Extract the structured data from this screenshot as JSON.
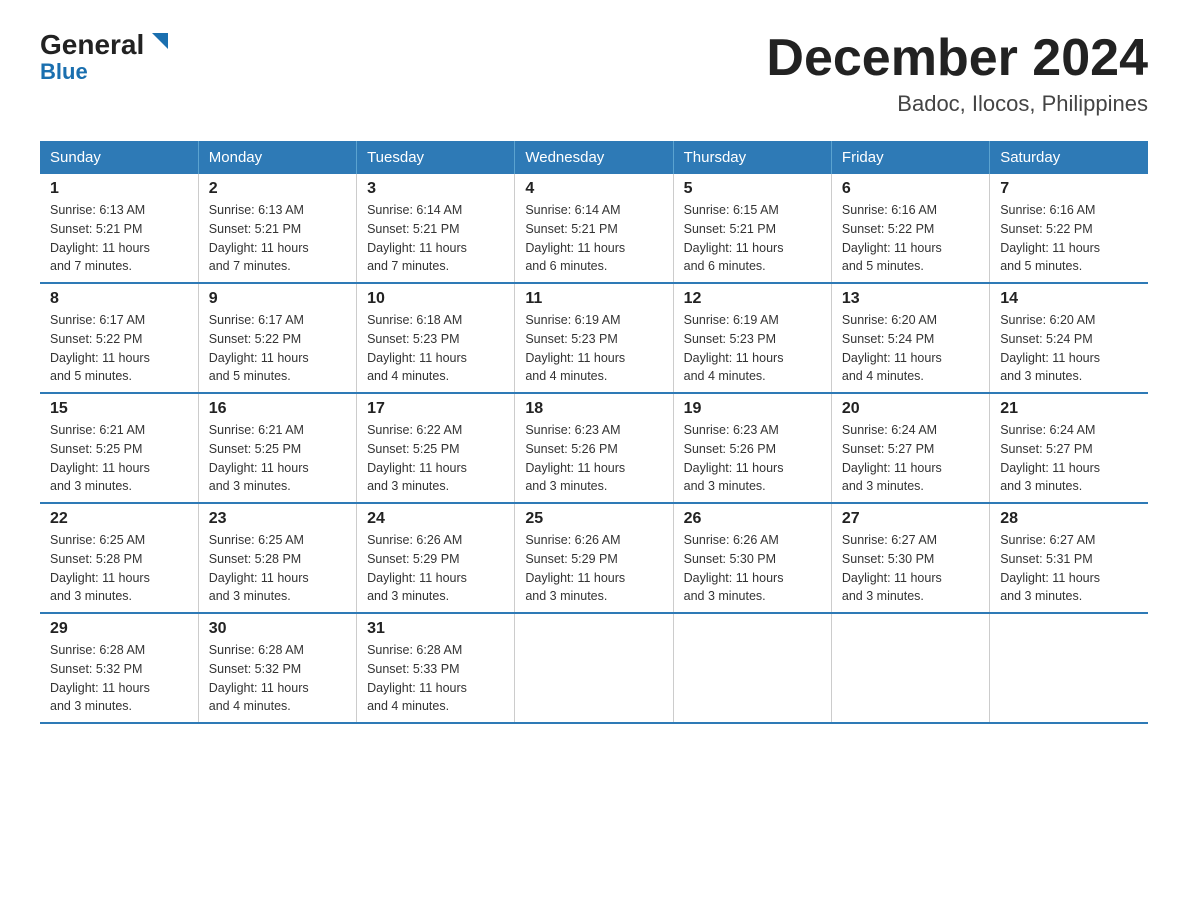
{
  "header": {
    "logo_general": "General",
    "logo_blue": "Blue",
    "title": "December 2024",
    "subtitle": "Badoc, Ilocos, Philippines"
  },
  "days_of_week": [
    "Sunday",
    "Monday",
    "Tuesday",
    "Wednesday",
    "Thursday",
    "Friday",
    "Saturday"
  ],
  "weeks": [
    [
      {
        "day": "1",
        "sunrise": "6:13 AM",
        "sunset": "5:21 PM",
        "daylight": "11 hours and 7 minutes."
      },
      {
        "day": "2",
        "sunrise": "6:13 AM",
        "sunset": "5:21 PM",
        "daylight": "11 hours and 7 minutes."
      },
      {
        "day": "3",
        "sunrise": "6:14 AM",
        "sunset": "5:21 PM",
        "daylight": "11 hours and 7 minutes."
      },
      {
        "day": "4",
        "sunrise": "6:14 AM",
        "sunset": "5:21 PM",
        "daylight": "11 hours and 6 minutes."
      },
      {
        "day": "5",
        "sunrise": "6:15 AM",
        "sunset": "5:21 PM",
        "daylight": "11 hours and 6 minutes."
      },
      {
        "day": "6",
        "sunrise": "6:16 AM",
        "sunset": "5:22 PM",
        "daylight": "11 hours and 5 minutes."
      },
      {
        "day": "7",
        "sunrise": "6:16 AM",
        "sunset": "5:22 PM",
        "daylight": "11 hours and 5 minutes."
      }
    ],
    [
      {
        "day": "8",
        "sunrise": "6:17 AM",
        "sunset": "5:22 PM",
        "daylight": "11 hours and 5 minutes."
      },
      {
        "day": "9",
        "sunrise": "6:17 AM",
        "sunset": "5:22 PM",
        "daylight": "11 hours and 5 minutes."
      },
      {
        "day": "10",
        "sunrise": "6:18 AM",
        "sunset": "5:23 PM",
        "daylight": "11 hours and 4 minutes."
      },
      {
        "day": "11",
        "sunrise": "6:19 AM",
        "sunset": "5:23 PM",
        "daylight": "11 hours and 4 minutes."
      },
      {
        "day": "12",
        "sunrise": "6:19 AM",
        "sunset": "5:23 PM",
        "daylight": "11 hours and 4 minutes."
      },
      {
        "day": "13",
        "sunrise": "6:20 AM",
        "sunset": "5:24 PM",
        "daylight": "11 hours and 4 minutes."
      },
      {
        "day": "14",
        "sunrise": "6:20 AM",
        "sunset": "5:24 PM",
        "daylight": "11 hours and 3 minutes."
      }
    ],
    [
      {
        "day": "15",
        "sunrise": "6:21 AM",
        "sunset": "5:25 PM",
        "daylight": "11 hours and 3 minutes."
      },
      {
        "day": "16",
        "sunrise": "6:21 AM",
        "sunset": "5:25 PM",
        "daylight": "11 hours and 3 minutes."
      },
      {
        "day": "17",
        "sunrise": "6:22 AM",
        "sunset": "5:25 PM",
        "daylight": "11 hours and 3 minutes."
      },
      {
        "day": "18",
        "sunrise": "6:23 AM",
        "sunset": "5:26 PM",
        "daylight": "11 hours and 3 minutes."
      },
      {
        "day": "19",
        "sunrise": "6:23 AM",
        "sunset": "5:26 PM",
        "daylight": "11 hours and 3 minutes."
      },
      {
        "day": "20",
        "sunrise": "6:24 AM",
        "sunset": "5:27 PM",
        "daylight": "11 hours and 3 minutes."
      },
      {
        "day": "21",
        "sunrise": "6:24 AM",
        "sunset": "5:27 PM",
        "daylight": "11 hours and 3 minutes."
      }
    ],
    [
      {
        "day": "22",
        "sunrise": "6:25 AM",
        "sunset": "5:28 PM",
        "daylight": "11 hours and 3 minutes."
      },
      {
        "day": "23",
        "sunrise": "6:25 AM",
        "sunset": "5:28 PM",
        "daylight": "11 hours and 3 minutes."
      },
      {
        "day": "24",
        "sunrise": "6:26 AM",
        "sunset": "5:29 PM",
        "daylight": "11 hours and 3 minutes."
      },
      {
        "day": "25",
        "sunrise": "6:26 AM",
        "sunset": "5:29 PM",
        "daylight": "11 hours and 3 minutes."
      },
      {
        "day": "26",
        "sunrise": "6:26 AM",
        "sunset": "5:30 PM",
        "daylight": "11 hours and 3 minutes."
      },
      {
        "day": "27",
        "sunrise": "6:27 AM",
        "sunset": "5:30 PM",
        "daylight": "11 hours and 3 minutes."
      },
      {
        "day": "28",
        "sunrise": "6:27 AM",
        "sunset": "5:31 PM",
        "daylight": "11 hours and 3 minutes."
      }
    ],
    [
      {
        "day": "29",
        "sunrise": "6:28 AM",
        "sunset": "5:32 PM",
        "daylight": "11 hours and 3 minutes."
      },
      {
        "day": "30",
        "sunrise": "6:28 AM",
        "sunset": "5:32 PM",
        "daylight": "11 hours and 4 minutes."
      },
      {
        "day": "31",
        "sunrise": "6:28 AM",
        "sunset": "5:33 PM",
        "daylight": "11 hours and 4 minutes."
      },
      null,
      null,
      null,
      null
    ]
  ],
  "labels": {
    "sunrise": "Sunrise:",
    "sunset": "Sunset:",
    "daylight": "Daylight:"
  }
}
